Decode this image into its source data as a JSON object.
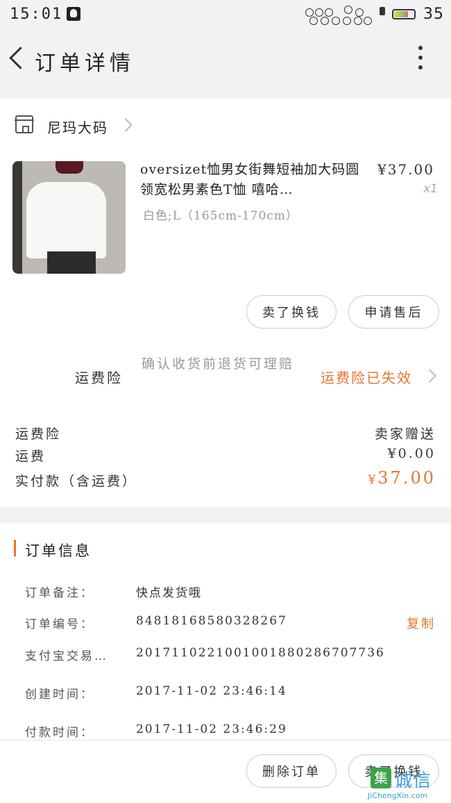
{
  "status_bar": {
    "time": "15:01",
    "battery": "35"
  },
  "nav": {
    "title": "订单详情"
  },
  "shop": {
    "name": "尼玛大码"
  },
  "product": {
    "title": "oversizet恤男女街舞短袖加大码圆领宽松男素色T恤 嘻哈…",
    "price": "¥37.00",
    "quantity": "x1",
    "spec": "白色;L（165cm-170cm）"
  },
  "actions": {
    "sell_label": "卖了换钱",
    "after_sale_label": "申请售后"
  },
  "insurance": {
    "label": "运费险",
    "description": "确认收货前退货可理赔",
    "status": "运费险已失效"
  },
  "fees": [
    {
      "label": "运费险",
      "value": "卖家赠送"
    },
    {
      "label": "运费",
      "value": "¥0.00"
    },
    {
      "label": "实付款（含运费）",
      "value": "37.00",
      "currency": "¥"
    }
  ],
  "order_info": {
    "title": "订单信息",
    "copy_label": "复制",
    "rows": [
      {
        "key": "订单备注：",
        "value": "快点发货哦"
      },
      {
        "key": "订单编号：",
        "value": "84818168580328267"
      },
      {
        "key": "支付宝交易…",
        "value": "2017110221001001880286707736"
      },
      {
        "key": "创建时间：",
        "value": "2017-11-02 23:46:14"
      },
      {
        "key": "付款时间：",
        "value": "2017-11-02 23:46:29"
      }
    ]
  },
  "bottom": {
    "delete_label": "删除订单",
    "sell_label": "卖了换钱"
  },
  "watermark": {
    "box": "集",
    "text": "诚信",
    "url": "JiChengXin.com"
  },
  "colors": {
    "accent": "#e8742c",
    "background": "#f2f2f2"
  }
}
